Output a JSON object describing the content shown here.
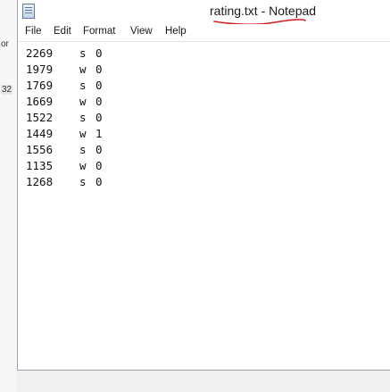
{
  "window": {
    "title": "rating.txt - Notepad"
  },
  "menu": [
    "File",
    "Edit",
    "Format",
    "View",
    "Help"
  ],
  "background_fragments": [
    "or",
    "32"
  ],
  "rows": [
    {
      "num": "2269",
      "ch": "s",
      "val": "0"
    },
    {
      "num": "1979",
      "ch": "w",
      "val": "0"
    },
    {
      "num": "1769",
      "ch": "s",
      "val": "0"
    },
    {
      "num": "1669",
      "ch": "w",
      "val": "0"
    },
    {
      "num": "1522",
      "ch": "s",
      "val": "0"
    },
    {
      "num": "1449",
      "ch": "w",
      "val": "1"
    },
    {
      "num": "1556",
      "ch": "s",
      "val": "0"
    },
    {
      "num": "1135",
      "ch": "w",
      "val": "0"
    },
    {
      "num": "1268",
      "ch": "s",
      "val": "0"
    }
  ],
  "colors": {
    "annotation": "#d02020",
    "frame": "#9aa3ad"
  },
  "icons": [
    "notepad-icon"
  ]
}
